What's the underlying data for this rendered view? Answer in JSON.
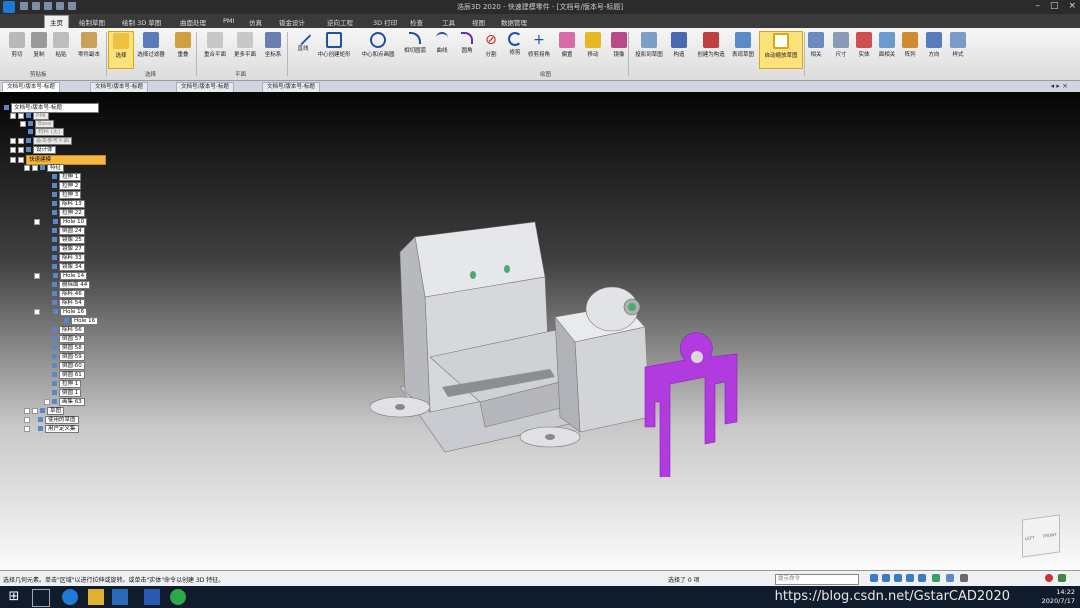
{
  "app": {
    "title": "浩辰3D 2020 - 快速建模零件 - [文档号/版本号-标题]"
  },
  "menu": {
    "tabs": [
      "主页",
      "绘制草图",
      "绘制 3D 草图",
      "曲面处理",
      "PMI",
      "仿真",
      "钣金设计",
      "逆向工程",
      "3D 打印",
      "检查",
      "工具",
      "视图",
      "数据管理"
    ]
  },
  "ribbon": {
    "buttons": [
      "剪切",
      "复制",
      "粘贴",
      "零件副本",
      "选择",
      "选择过滤器",
      "重叠",
      "重合平面",
      "更多平面",
      "坐标系",
      "直线",
      "中心创建矩形",
      "中心和点画圆",
      "相切圆弧",
      "曲线",
      "圆角",
      "分割",
      "修剪",
      "修剪拐角",
      "偏置",
      "移动",
      "镜像",
      "投影到草图",
      "构造",
      "创建为构造",
      "表现草图",
      "自动缩放草图",
      "相关",
      "尺寸",
      "实体",
      "面相关",
      "阵列",
      "方向",
      "样式"
    ],
    "groups": [
      "剪贴板",
      "选择",
      "平面",
      "绘图"
    ]
  },
  "doc_tabs": [
    "文档号/版本号-标题",
    "文档号/版本号-标题",
    "文档号/版本号-标题",
    "文档号/版本号-标题"
  ],
  "tree": {
    "root": "文档号/版本号-标题",
    "items": [
      "PMI",
      "Base",
      "材料 (无)",
      "基本参考平面",
      "设计体",
      "快速建模",
      "特征",
      "拉伸 1",
      "拉伸 2",
      "拉伸 3",
      "除料 13",
      "拉伸 22",
      "Hole 10",
      "倒圆 24",
      "镜像 25",
      "镜像 27",
      "除料 33",
      "镜像 34",
      "Hole 14",
      "删除面 44",
      "除料 46",
      "除料 54",
      "Hole 16",
      "Hole 16",
      "除料 56",
      "倒圆 57",
      "倒圆 58",
      "倒圆 59",
      "倒圆 60",
      "倒圆 61",
      "拉伸 1",
      "倒圆 1",
      "画集 63",
      "草图",
      "使用的草图",
      "用户定义集"
    ]
  },
  "viewcube": {
    "left": "LEFT",
    "front": "FRONT"
  },
  "status": {
    "message": "选择几何元素。单击\"区域\"以进行拉伸或旋转。或单击\"实体\"命令以创建 3D 特征。",
    "selected": "选择了 0 项",
    "command_placeholder": "提示命令"
  },
  "taskbar": {
    "watermark": "https://blog.csdn.net/GstarCAD2020",
    "date": "2020/7/17",
    "time": "14:22"
  },
  "colors": {
    "accent": "#f5b83d",
    "model": "#d7d9de",
    "highlight": "#b23be0",
    "ribbon_highlight": "#fbe27a"
  }
}
